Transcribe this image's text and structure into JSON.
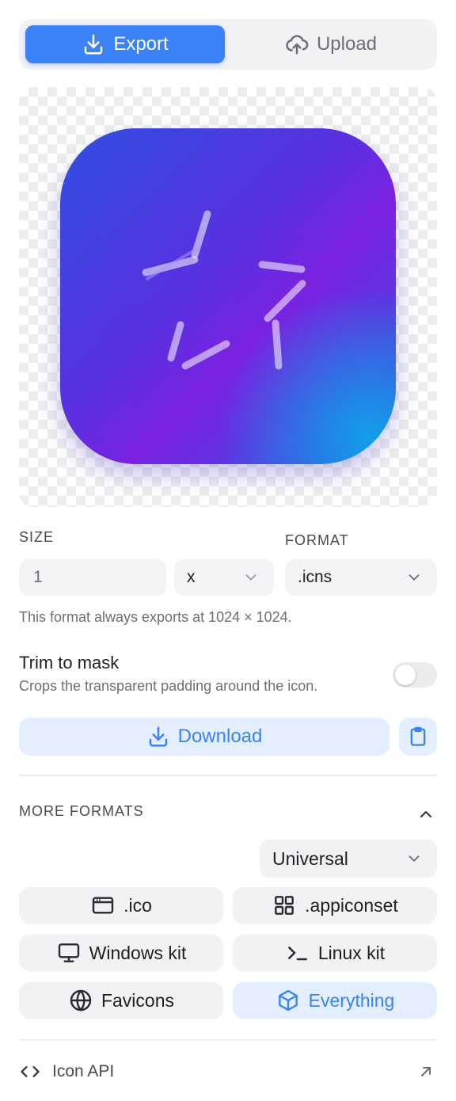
{
  "tabs": {
    "export_label": "Export",
    "upload_label": "Upload"
  },
  "size": {
    "label": "SIZE",
    "value": "1",
    "multiplier": "x"
  },
  "format": {
    "label": "FORMAT",
    "value": ".icns"
  },
  "hint": "This format always exports at 1024 × 1024.",
  "trim": {
    "title": "Trim to mask",
    "description": "Crops the transparent padding around the icon.",
    "enabled": false
  },
  "download_label": "Download",
  "more_formats": {
    "label": "MORE FORMATS",
    "platform": "Universal",
    "items": [
      {
        "label": ".ico",
        "icon": "window-icon"
      },
      {
        "label": ".appiconset",
        "icon": "grid-icon"
      },
      {
        "label": "Windows kit",
        "icon": "monitor-icon"
      },
      {
        "label": "Linux kit",
        "icon": "terminal-icon"
      },
      {
        "label": "Favicons",
        "icon": "globe-icon"
      },
      {
        "label": "Everything",
        "icon": "box-icon"
      }
    ]
  },
  "api": {
    "label": "Icon API"
  },
  "colors": {
    "accent": "#3b82f6",
    "accent_soft": "#e3efff"
  }
}
